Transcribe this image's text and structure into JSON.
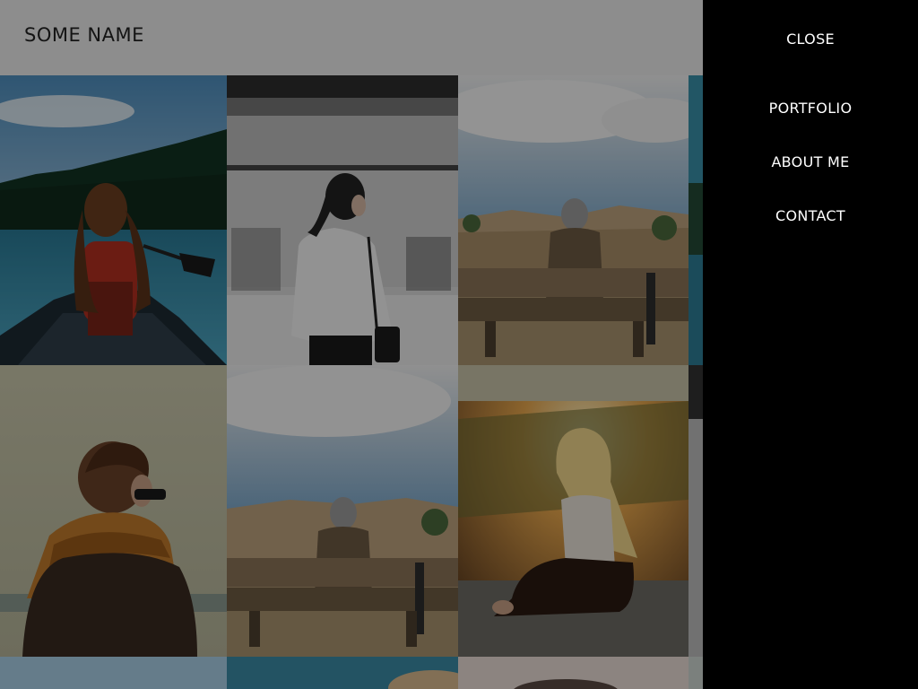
{
  "header": {
    "site_title": "SOME NAME"
  },
  "menu": {
    "close_label": "CLOSE",
    "items": [
      {
        "label": "PORTFOLIO"
      },
      {
        "label": "ABOUT ME"
      },
      {
        "label": "CONTACT"
      }
    ]
  },
  "state": {
    "menu_open": true,
    "overlay": "dimmed"
  },
  "colors": {
    "menu_bg": "#000000",
    "menu_text": "#ffffff",
    "title_text": "#222222"
  }
}
